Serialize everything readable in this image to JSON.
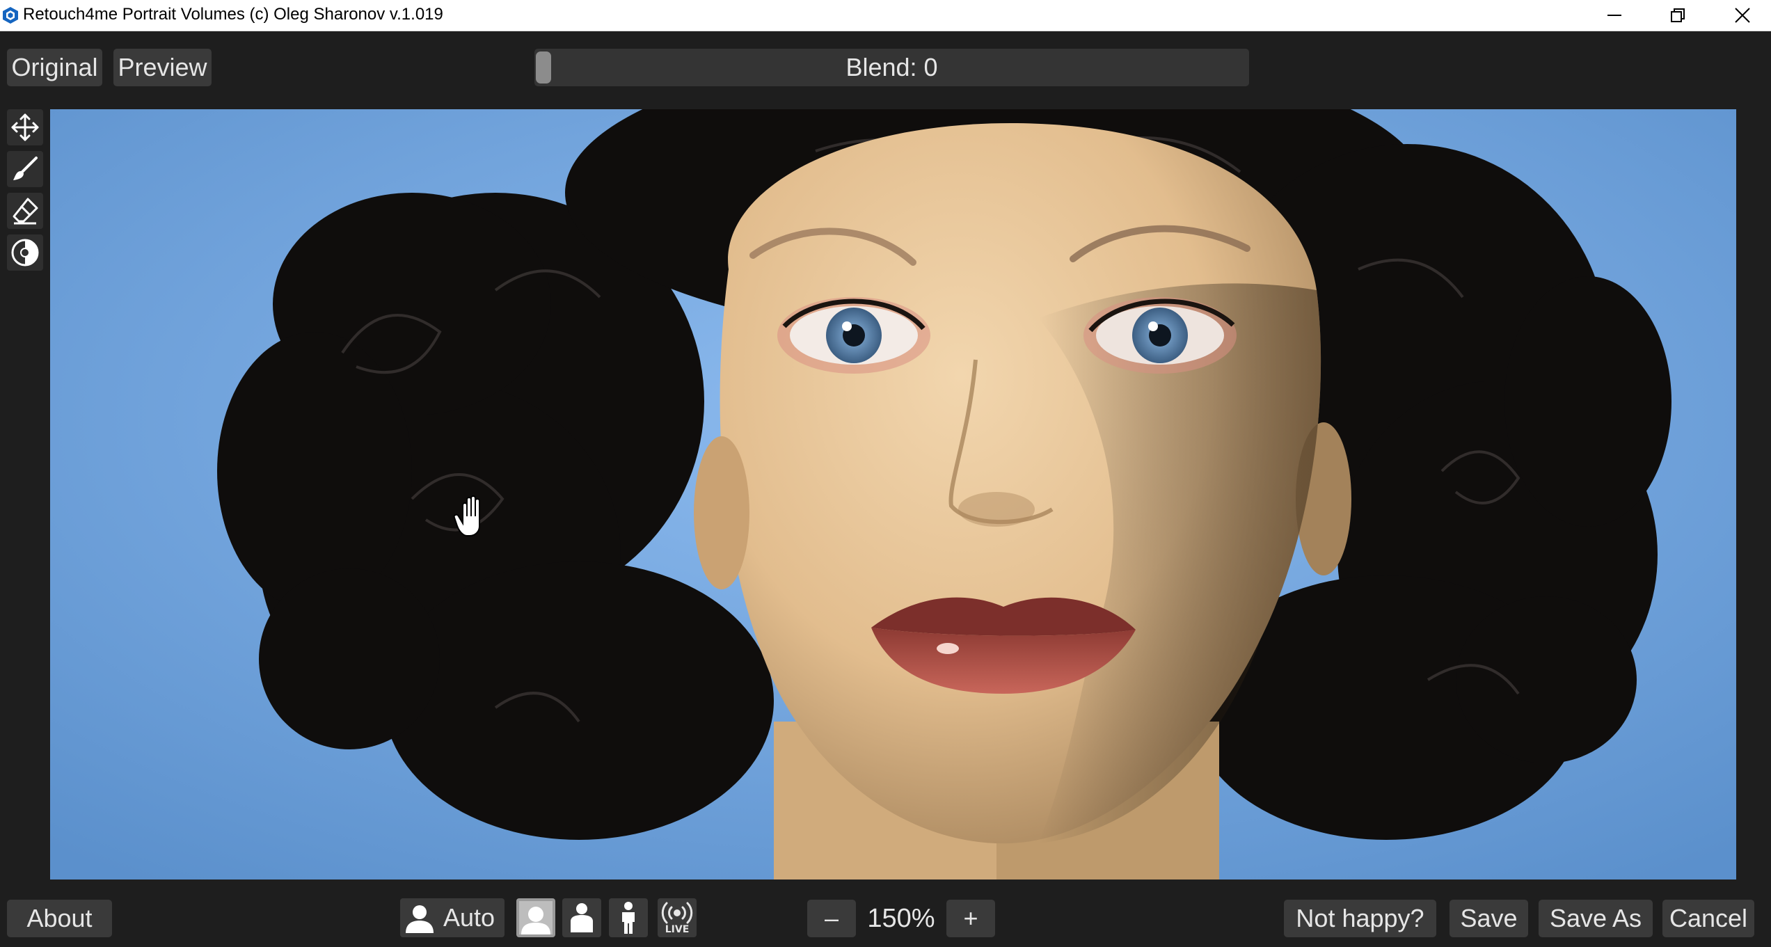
{
  "window": {
    "title": "Retouch4me Portrait Volumes (c) Oleg Sharonov v.1.019",
    "logo_icon": "retouch4me-logo-icon",
    "controls": [
      "minimize-icon",
      "restore-icon",
      "close-icon"
    ]
  },
  "toolbar": {
    "original_label": "Original",
    "preview_label": "Preview",
    "blend_label": "Blend: 0",
    "blend_value": 0
  },
  "tools": [
    {
      "name": "move-tool",
      "icon": "move-arrows-icon"
    },
    {
      "name": "brush-tool",
      "icon": "brush-icon"
    },
    {
      "name": "eraser-tool",
      "icon": "eraser-icon"
    },
    {
      "name": "mask-tool",
      "icon": "mask-circle-icon"
    }
  ],
  "bottom": {
    "about_label": "About",
    "auto_label": "Auto",
    "modes": [
      {
        "name": "portrait-mode",
        "icon": "head-portrait-icon",
        "active": true
      },
      {
        "name": "half-body-mode",
        "icon": "half-body-icon",
        "active": false
      },
      {
        "name": "full-body-mode",
        "icon": "full-body-icon",
        "active": false
      },
      {
        "name": "live-mode",
        "icon": "live-broadcast-icon",
        "label": "LIVE",
        "active": false
      }
    ],
    "zoom_minus": "–",
    "zoom_value": "150%",
    "zoom_plus": "+",
    "not_happy_label": "Not happy?",
    "save_label": "Save",
    "save_as_label": "Save As",
    "cancel_label": "Cancel"
  },
  "colors": {
    "background": "#1e1e1e",
    "button": "#3a3a3a",
    "button_text": "#e6e6e6",
    "photo_backdrop": "#6a9fd8"
  }
}
